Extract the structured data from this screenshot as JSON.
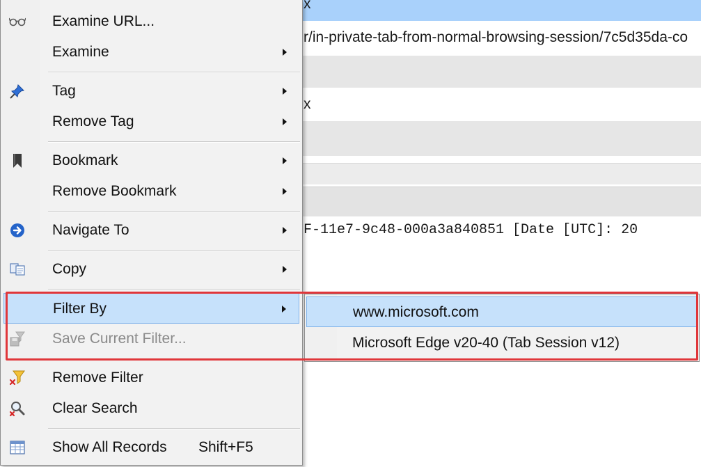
{
  "background": {
    "row1_text": "x",
    "row2_text": "r/in-private-tab-from-normal-browsing-session/7c5d35da-co",
    "row3_text": "x",
    "detail_text": "F-11e7-9c48-000a3a840851  [Date [UTC]: 20",
    "colors": {
      "selected_row": "#a9d1fb",
      "grid_row": "#e6e6e6"
    }
  },
  "menu": {
    "items": [
      {
        "label": "Examine URL...",
        "icon": "glasses-icon",
        "submenu": false
      },
      {
        "label": "Examine",
        "icon": "",
        "submenu": true
      },
      {
        "label": "Tag",
        "icon": "pushpin-icon",
        "submenu": true
      },
      {
        "label": "Remove Tag",
        "icon": "",
        "submenu": true
      },
      {
        "label": "Bookmark",
        "icon": "bookmark-icon",
        "submenu": true
      },
      {
        "label": "Remove Bookmark",
        "icon": "",
        "submenu": true
      },
      {
        "label": "Navigate To",
        "icon": "arrow-circle-icon",
        "submenu": true
      },
      {
        "label": "Copy",
        "icon": "copy-icon",
        "submenu": true
      },
      {
        "label": "Filter By",
        "icon": "",
        "submenu": true,
        "highlighted": true
      },
      {
        "label": "Save Current Filter...",
        "icon": "save-filter-icon",
        "submenu": false,
        "disabled": true
      },
      {
        "label": "Remove Filter",
        "icon": "remove-filter-icon",
        "submenu": false
      },
      {
        "label": "Clear Search",
        "icon": "clear-search-icon",
        "submenu": false
      },
      {
        "label": "Show All Records",
        "shortcut": "Shift+F5",
        "icon": "table-icon",
        "submenu": false
      }
    ]
  },
  "submenu": {
    "items": [
      {
        "label": "www.microsoft.com",
        "highlighted": true
      },
      {
        "label": "Microsoft Edge v20-40 (Tab Session v12)"
      }
    ]
  },
  "annotation": {
    "color": "#e0363a"
  }
}
